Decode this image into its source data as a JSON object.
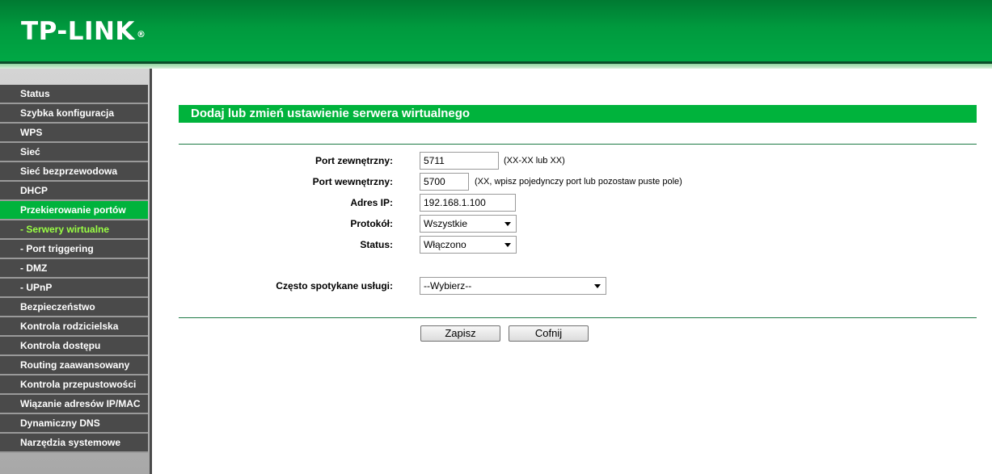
{
  "header": {
    "logo": "TP-LINK",
    "logo_mark": "®"
  },
  "sidebar": {
    "items": [
      {
        "label": "Status"
      },
      {
        "label": "Szybka konfiguracja"
      },
      {
        "label": "WPS"
      },
      {
        "label": "Sieć"
      },
      {
        "label": "Sieć bezprzewodowa"
      },
      {
        "label": "DHCP"
      },
      {
        "label": "Przekierowanie portów"
      },
      {
        "label": "- Serwery wirtualne"
      },
      {
        "label": "- Port triggering"
      },
      {
        "label": "- DMZ"
      },
      {
        "label": "- UPnP"
      },
      {
        "label": "Bezpieczeństwo"
      },
      {
        "label": "Kontrola rodzicielska"
      },
      {
        "label": "Kontrola dostępu"
      },
      {
        "label": "Routing zaawansowany"
      },
      {
        "label": "Kontrola przepustowości"
      },
      {
        "label": "Wiązanie adresów IP/MAC"
      },
      {
        "label": "Dynamiczny DNS"
      },
      {
        "label": "Narzędzia systemowe"
      }
    ]
  },
  "form": {
    "title": "Dodaj lub zmień ustawienie serwera wirtualnego",
    "external_port": {
      "label": "Port zewnętrzny:",
      "value": "5711",
      "hint": "(XX-XX lub XX)"
    },
    "internal_port": {
      "label": "Port wewnętrzny:",
      "value": "5700",
      "hint": "(XX, wpisz pojedynczy port lub pozostaw puste pole)"
    },
    "ip_address": {
      "label": "Adres IP:",
      "value": "192.168.1.100"
    },
    "protocol": {
      "label": "Protokół:",
      "value": "Wszystkie"
    },
    "status": {
      "label": "Status:",
      "value": "Włączono"
    },
    "common_services": {
      "label": "Często spotykane usługi:",
      "value": "--Wybierz--"
    },
    "save_label": "Zapisz",
    "back_label": "Cofnij"
  }
}
